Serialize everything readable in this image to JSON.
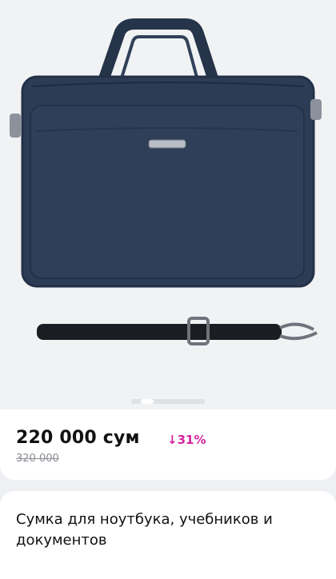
{
  "product": {
    "price": "220 000 сум",
    "discount": "↓31%",
    "old_price": "320 000",
    "title": "Сумка для ноутбука, учебников и документов"
  },
  "gallery": {
    "image": "navy laptop bag with shoulder strap",
    "current_index": 2,
    "colors": {
      "bag": "#2b3a52",
      "strap": "#1c1d22"
    }
  },
  "colors": {
    "discount": "#d6249f",
    "old_price": "#8b8e94"
  }
}
